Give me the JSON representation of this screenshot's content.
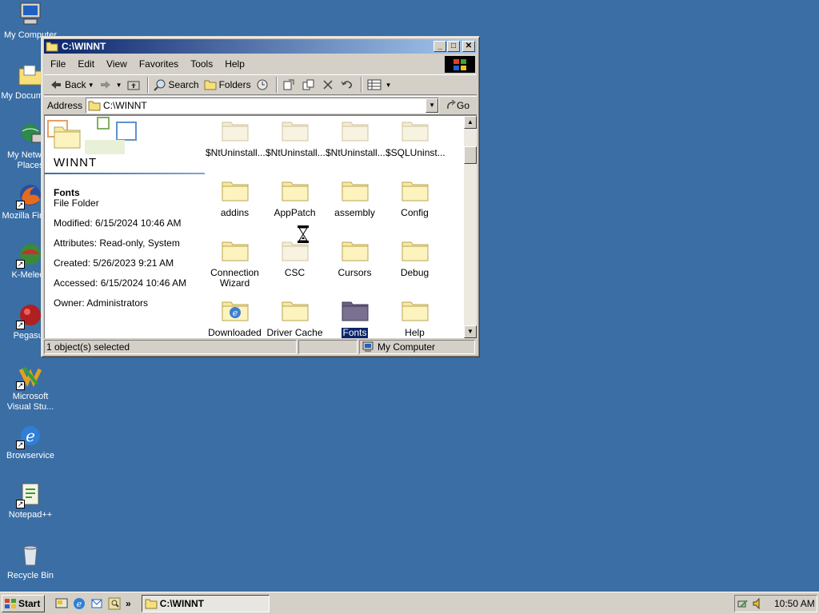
{
  "desktop": {
    "icons": [
      {
        "label": "My Computer",
        "icon": "my-computer-icon"
      },
      {
        "label": "My Documents",
        "icon": "my-documents-icon"
      },
      {
        "label": "My Network Places",
        "icon": "network-places-icon"
      },
      {
        "label": "Mozilla Firefox",
        "icon": "firefox-icon"
      },
      {
        "label": "K-Meleon",
        "icon": "k-meleon-icon"
      },
      {
        "label": "Pegasus",
        "icon": "pegasus-icon"
      },
      {
        "label": "Microsoft Visual Stu...",
        "icon": "visual-studio-icon"
      },
      {
        "label": "Browservice",
        "icon": "ie-icon"
      },
      {
        "label": "Notepad++",
        "icon": "notepadpp-icon"
      },
      {
        "label": "Recycle Bin",
        "icon": "recycle-bin-icon"
      }
    ]
  },
  "window": {
    "title": "C:\\WINNT",
    "menu": [
      "File",
      "Edit",
      "View",
      "Favorites",
      "Tools",
      "Help"
    ],
    "toolbar": {
      "back": "Back",
      "search": "Search",
      "folders": "Folders"
    },
    "address": {
      "label": "Address",
      "value": "C:\\WINNT",
      "go": "Go"
    },
    "info": {
      "folder_title": "WINNT",
      "selected_name": "Fonts",
      "selected_type": "File Folder",
      "modified": "Modified: 6/15/2024 10:46 AM",
      "attributes": "Attributes: Read-only, System",
      "created": "Created: 5/26/2023 9:21 AM",
      "accessed": "Accessed: 6/15/2024 10:46 AM",
      "owner": "Owner: Administrators"
    },
    "files": [
      {
        "line1": "$NtUninstall...",
        "line2": "",
        "kind": "hidden-folder"
      },
      {
        "line1": "$NtUninstall...",
        "line2": "",
        "kind": "hidden-folder"
      },
      {
        "line1": "$NtUninstall...",
        "line2": "",
        "kind": "hidden-folder"
      },
      {
        "line1": "$SQLUninst...",
        "line2": "",
        "kind": "hidden-folder"
      },
      {
        "line1": "addins",
        "line2": "",
        "kind": "folder"
      },
      {
        "line1": "AppPatch",
        "line2": "",
        "kind": "folder"
      },
      {
        "line1": "assembly",
        "line2": "",
        "kind": "folder"
      },
      {
        "line1": "Config",
        "line2": "",
        "kind": "folder"
      },
      {
        "line1": "Connection",
        "line2": "Wizard",
        "kind": "folder"
      },
      {
        "line1": "CSC",
        "line2": "",
        "kind": "hidden-folder"
      },
      {
        "line1": "Cursors",
        "line2": "",
        "kind": "folder"
      },
      {
        "line1": "Debug",
        "line2": "",
        "kind": "folder"
      },
      {
        "line1": "Downloaded",
        "line2": "",
        "kind": "ie-folder"
      },
      {
        "line1": "Driver Cache",
        "line2": "",
        "kind": "folder"
      },
      {
        "line1": "Fonts",
        "line2": "",
        "kind": "selected-folder"
      },
      {
        "line1": "Help",
        "line2": "",
        "kind": "folder"
      }
    ],
    "status": {
      "selection": "1 object(s) selected",
      "zone": "My Computer"
    }
  },
  "taskbar": {
    "start": "Start",
    "task": "C:\\WINNT",
    "clock": "10:50 AM"
  },
  "colors": {
    "desktop": "#3a6ea5",
    "titlebar_start": "#0a246a",
    "titlebar_end": "#a6caf0",
    "face": "#d4d0c8",
    "folder": "#f6e7a3",
    "selection": "#0a246a"
  }
}
